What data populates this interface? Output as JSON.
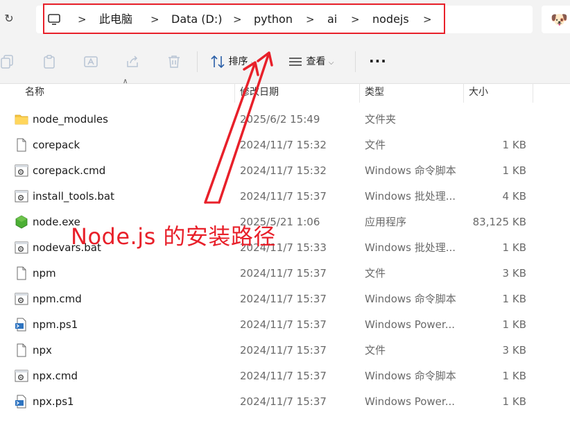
{
  "address_bar": {
    "home_icon": "monitor-icon",
    "crumbs": [
      "此电脑",
      "Data (D:)",
      "python",
      "ai",
      "nodejs"
    ],
    "separator": ">",
    "highlight_color": "#e8202a"
  },
  "toolbar": {
    "sort_label": "排序",
    "view_label": "查看",
    "more_label": "···"
  },
  "columns": {
    "name": "名称",
    "date": "修改日期",
    "type": "类型",
    "size": "大小"
  },
  "files": [
    {
      "name": "node_modules",
      "date": "2025/6/2 15:49",
      "type": "文件夹",
      "size": "",
      "icon": "folder-icon"
    },
    {
      "name": "corepack",
      "date": "2024/11/7 15:32",
      "type": "文件",
      "size": "1 KB",
      "icon": "file-icon"
    },
    {
      "name": "corepack.cmd",
      "date": "2024/11/7 15:32",
      "type": "Windows 命令脚本",
      "size": "1 KB",
      "icon": "script-gear-icon"
    },
    {
      "name": "install_tools.bat",
      "date": "2024/11/7 15:37",
      "type": "Windows 批处理...",
      "size": "4 KB",
      "icon": "script-gear-icon"
    },
    {
      "name": "node.exe",
      "date": "2025/5/21 1:06",
      "type": "应用程序",
      "size": "83,125 KB",
      "icon": "node-hexagon-icon"
    },
    {
      "name": "nodevars.bat",
      "date": "2024/11/7 15:33",
      "type": "Windows 批处理...",
      "size": "1 KB",
      "icon": "script-gear-icon"
    },
    {
      "name": "npm",
      "date": "2024/11/7 15:37",
      "type": "文件",
      "size": "3 KB",
      "icon": "file-icon"
    },
    {
      "name": "npm.cmd",
      "date": "2024/11/7 15:37",
      "type": "Windows 命令脚本",
      "size": "1 KB",
      "icon": "script-gear-icon"
    },
    {
      "name": "npm.ps1",
      "date": "2024/11/7 15:37",
      "type": "Windows Power...",
      "size": "1 KB",
      "icon": "powershell-file-icon"
    },
    {
      "name": "npx",
      "date": "2024/11/7 15:37",
      "type": "文件",
      "size": "3 KB",
      "icon": "file-icon"
    },
    {
      "name": "npx.cmd",
      "date": "2024/11/7 15:37",
      "type": "Windows 命令脚本",
      "size": "1 KB",
      "icon": "script-gear-icon"
    },
    {
      "name": "npx.ps1",
      "date": "2024/11/7 15:37",
      "type": "Windows Power...",
      "size": "1 KB",
      "icon": "powershell-file-icon"
    }
  ],
  "annotation": {
    "text": "Node.js 的安装路径",
    "color": "#e8202a"
  }
}
